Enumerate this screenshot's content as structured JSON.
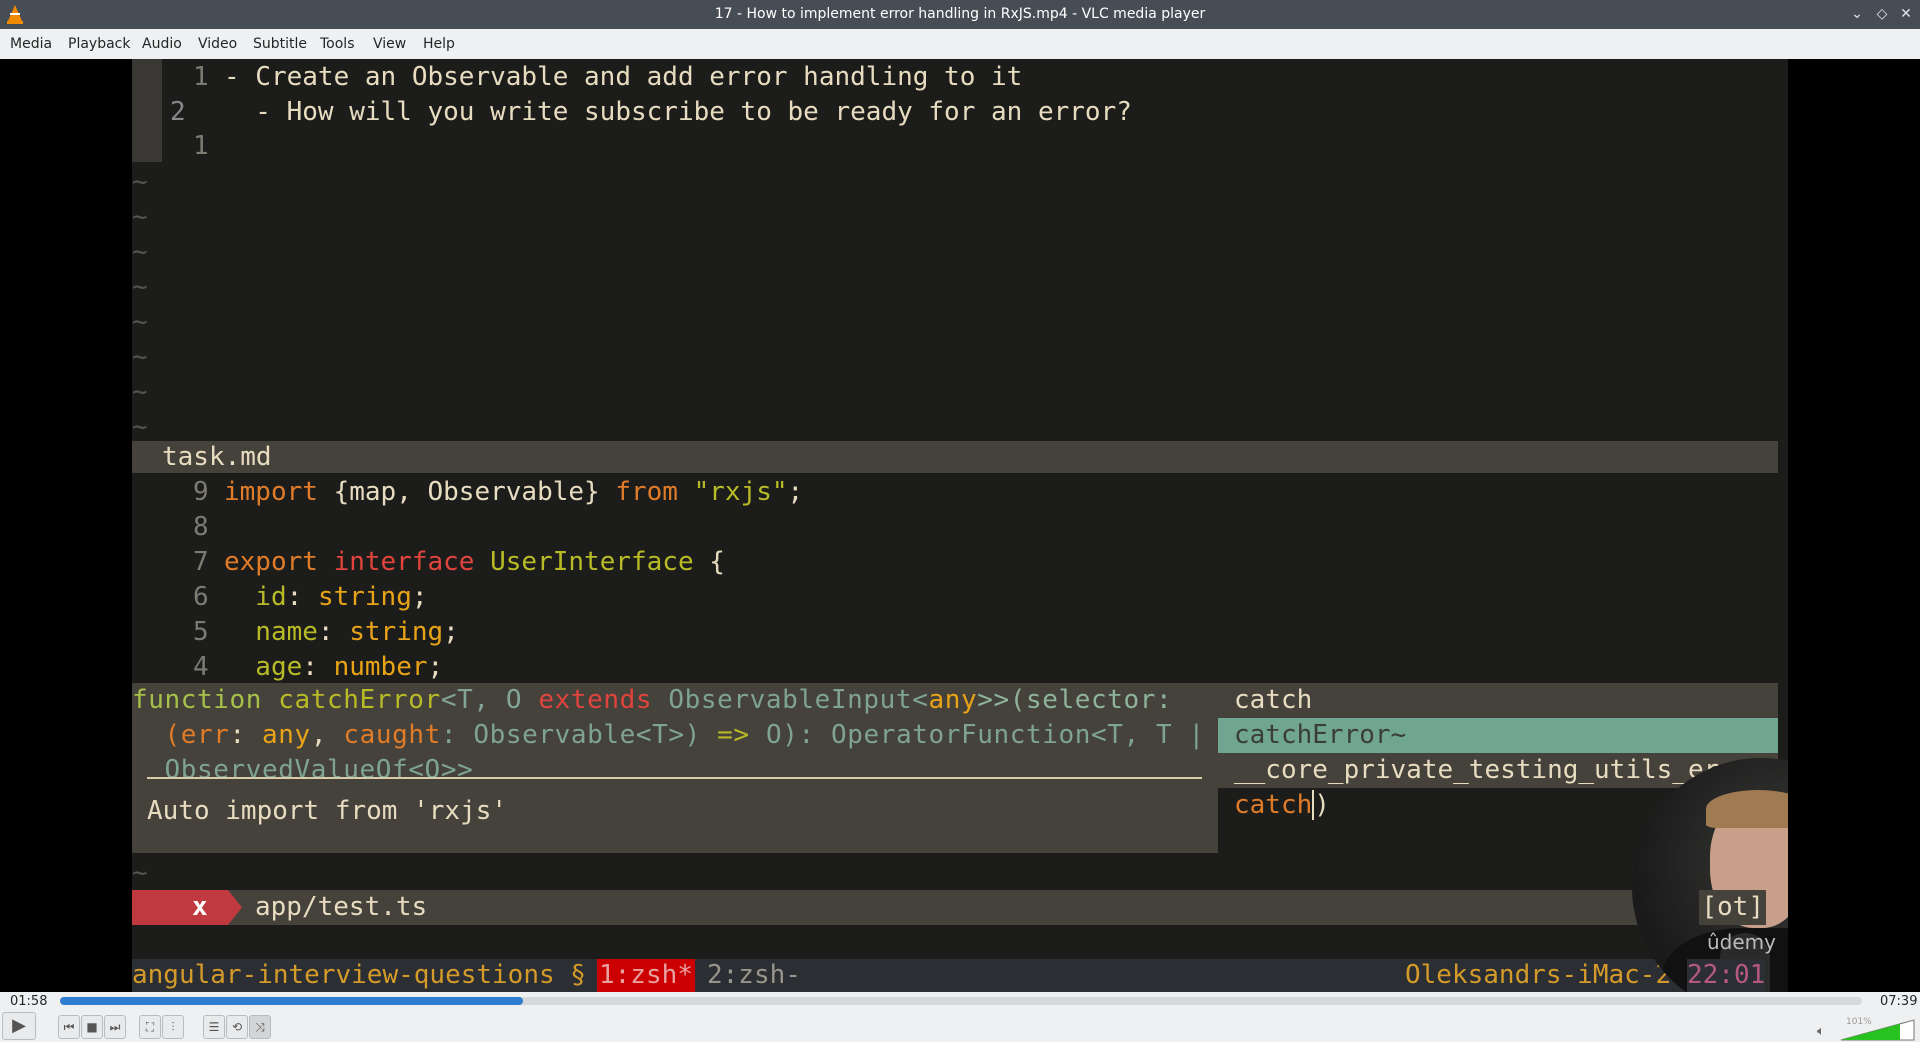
{
  "window": {
    "title": "17 - How to implement error handling in RxJS.mp4 - VLC media player"
  },
  "menu": [
    "Media",
    "Playback",
    "Audio",
    "Video",
    "Subtitle",
    "Tools",
    "View",
    "Help"
  ],
  "editor": {
    "top_pane": [
      {
        "num": "1",
        "text": "- Create an Observable and add error handling to it"
      },
      {
        "num": "2",
        "text": "  - How will you write subscribe to be ready for an error?"
      },
      {
        "num": "1",
        "text": ""
      }
    ],
    "tilde": "~",
    "statusbar_file": "task.md",
    "code": [
      {
        "num": "9",
        "tokens": [
          {
            "t": "import ",
            "c": "#e07b28"
          },
          {
            "t": "{map, Observable} ",
            "c": "#e8dcc0"
          },
          {
            "t": "from ",
            "c": "#e07b28"
          },
          {
            "t": "\"rxjs\"",
            "c": "#b8bb26"
          },
          {
            "t": ";",
            "c": "#e8dcc0"
          }
        ]
      },
      {
        "num": "8",
        "tokens": []
      },
      {
        "num": "7",
        "tokens": [
          {
            "t": "export ",
            "c": "#e07b28"
          },
          {
            "t": "interface ",
            "c": "#e0443c"
          },
          {
            "t": "UserInterface ",
            "c": "#b8bb26"
          },
          {
            "t": "{",
            "c": "#e8dcc0"
          }
        ]
      },
      {
        "num": "6",
        "tokens": [
          {
            "t": "  id",
            "c": "#b8bb26"
          },
          {
            "t": ": ",
            "c": "#e8dcc0"
          },
          {
            "t": "string",
            "c": "#e8a317"
          },
          {
            "t": ";",
            "c": "#e8dcc0"
          }
        ]
      },
      {
        "num": "5",
        "tokens": [
          {
            "t": "  name",
            "c": "#b8bb26"
          },
          {
            "t": ": ",
            "c": "#e8dcc0"
          },
          {
            "t": "string",
            "c": "#e8a317"
          },
          {
            "t": ";",
            "c": "#e8dcc0"
          }
        ]
      },
      {
        "num": "4",
        "tokens": [
          {
            "t": "  age",
            "c": "#b8bb26"
          },
          {
            "t": ": ",
            "c": "#e8dcc0"
          },
          {
            "t": "number",
            "c": "#e8a317"
          },
          {
            "t": ";",
            "c": "#e8dcc0"
          }
        ]
      }
    ],
    "signature": [
      [
        {
          "t": "function ",
          "c": "#a6c14a"
        },
        {
          "t": "catchError",
          "c": "#b8bb26"
        },
        {
          "t": "<T, O ",
          "c": "#83a598"
        },
        {
          "t": "extends ",
          "c": "#e0443c"
        },
        {
          "t": "ObservableInput<",
          "c": "#7fa393"
        },
        {
          "t": "any",
          "c": "#e8a317"
        },
        {
          "t": ">>(selector:",
          "c": "#8fb39a"
        }
      ],
      [
        {
          "t": "  (",
          "c": "#e07b28"
        },
        {
          "t": "err",
          "c": "#e07b28"
        },
        {
          "t": ": ",
          "c": "#e8dcc0"
        },
        {
          "t": "any",
          "c": "#e8a317"
        },
        {
          "t": ", ",
          "c": "#e8dcc0"
        },
        {
          "t": "caught",
          "c": "#e07b28"
        },
        {
          "t": ": Observable<T>) ",
          "c": "#7fa393"
        },
        {
          "t": "=> ",
          "c": "#b8bb26"
        },
        {
          "t": "O): OperatorFunction<T, T |",
          "c": "#7fa393"
        }
      ],
      [
        {
          "t": "  ObservedValueOf<O>>",
          "c": "#7fa393"
        }
      ]
    ],
    "auto_import": "Auto import from 'rxjs'",
    "completions": [
      "catch",
      "catchError~",
      "__core_private_testing_utils_error_"
    ],
    "typed": "catch",
    "typed_paren": ")",
    "appbar": {
      "error_mark": "x",
      "file": "app/test.ts",
      "right": "[ot]"
    },
    "tmux": {
      "session": "angular-interview-questions §",
      "win1": "1:zsh*",
      "win2": "2:zsh-",
      "host": "Oleksandrs-iMac-2",
      "time": "22:01"
    },
    "watermark": "ûdemy"
  },
  "player": {
    "elapsed": "01:58",
    "total": "07:39",
    "progress": 0.257,
    "volume_label": "101%",
    "volume": 1.01
  },
  "colors": {
    "accent": "#2f7dd1",
    "volume": "#27c21f"
  }
}
